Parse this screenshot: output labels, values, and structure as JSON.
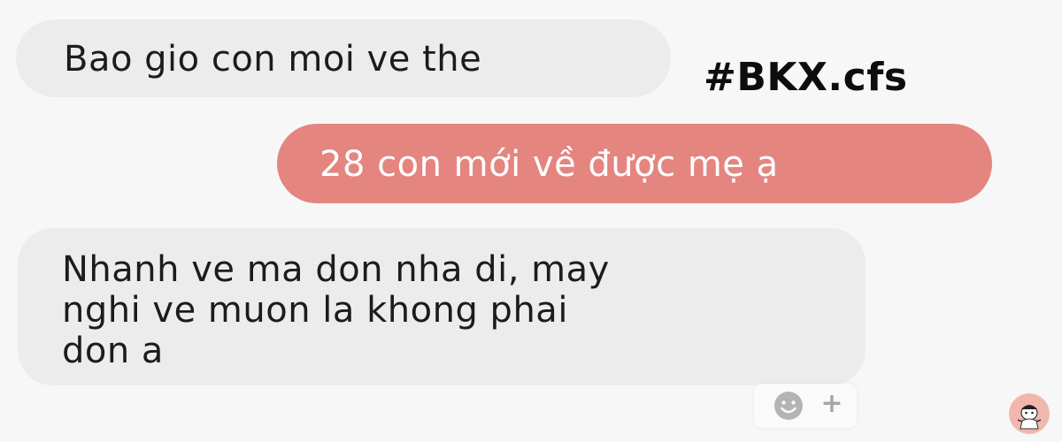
{
  "messages": {
    "incoming_1": "Bao gio con moi ve the",
    "outgoing_1": "28 con mới về được mẹ ạ",
    "incoming_2": {
      "lines": [
        "Nhanh ve ma don nha di, may",
        "nghi ve muon la khong phai",
        "don a"
      ]
    }
  },
  "watermark": {
    "hashtag": "#BKX.cfs"
  },
  "reaction": {
    "plus": "+"
  },
  "colors": {
    "incoming_bubble": "#ececec",
    "outgoing_bubble": "#e48580",
    "background": "#f7f7f7",
    "avatar_bg": "#f1b7ad"
  },
  "icons": {
    "add_reaction": "smiley-icon",
    "avatar": "avatar-icon"
  }
}
